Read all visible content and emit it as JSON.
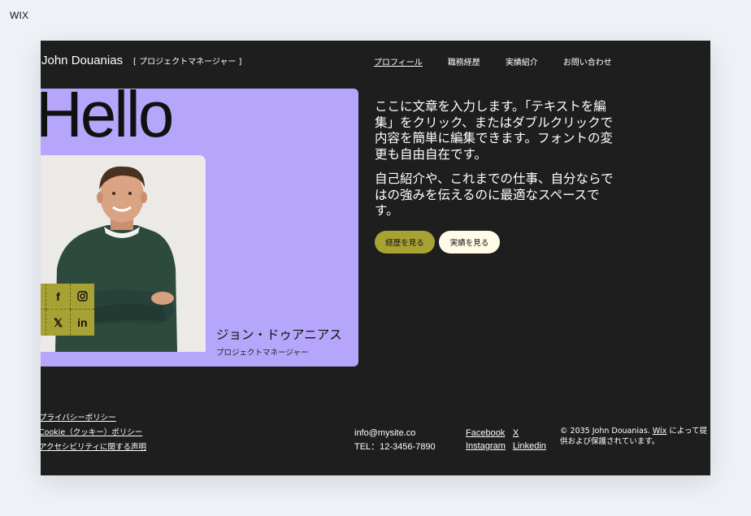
{
  "editor": {
    "logo": "WIX"
  },
  "header": {
    "site_name": "John Douanias",
    "role": "[ プロジェクトマネージャー ]",
    "nav": [
      {
        "label": "プロフィール"
      },
      {
        "label": "職務経歴"
      },
      {
        "label": "実績紹介"
      },
      {
        "label": "お問い合わせ"
      }
    ]
  },
  "hero": {
    "greeting": "Hello",
    "name": "ジョン・ドゥアニアス",
    "role": "プロジェクトマネージャー",
    "social_icons": [
      "pinterest-icon",
      "facebook-icon",
      "instagram-icon",
      "tiktok-icon",
      "x-icon",
      "linkedin-icon"
    ]
  },
  "intro": {
    "paragraph1": "ここに文章を入力します。「テキストを編集」をクリック、またはダブルクリックで内容を簡単に編集できます。フォントの変更も自由自在です。",
    "paragraph2": "自己紹介や、これまでの仕事、自分ならではの強みを伝えるのに最適なスペースです。",
    "btn_career": "経歴を見る",
    "btn_works": "実績を見る"
  },
  "footer": {
    "links": [
      "プライバシーポリシー",
      "Cookie（クッキー）ポリシー",
      "アクセシビリティに関する声明"
    ],
    "email": "info@mysite.co",
    "tel": "TEL：12-3456-7890",
    "socials": [
      "Facebook",
      "X",
      "Instagram",
      "Linkedin"
    ],
    "copyright_pre": "© 2035 John Douanias.",
    "copyright_link": "Wix",
    "copyright_post": "によって提供および保護されています。"
  },
  "colors": {
    "background": "#1e1e1e",
    "hero_card": "#b5a6fb",
    "accent_olive": "#a8a235",
    "button_light": "#fffbe6"
  }
}
